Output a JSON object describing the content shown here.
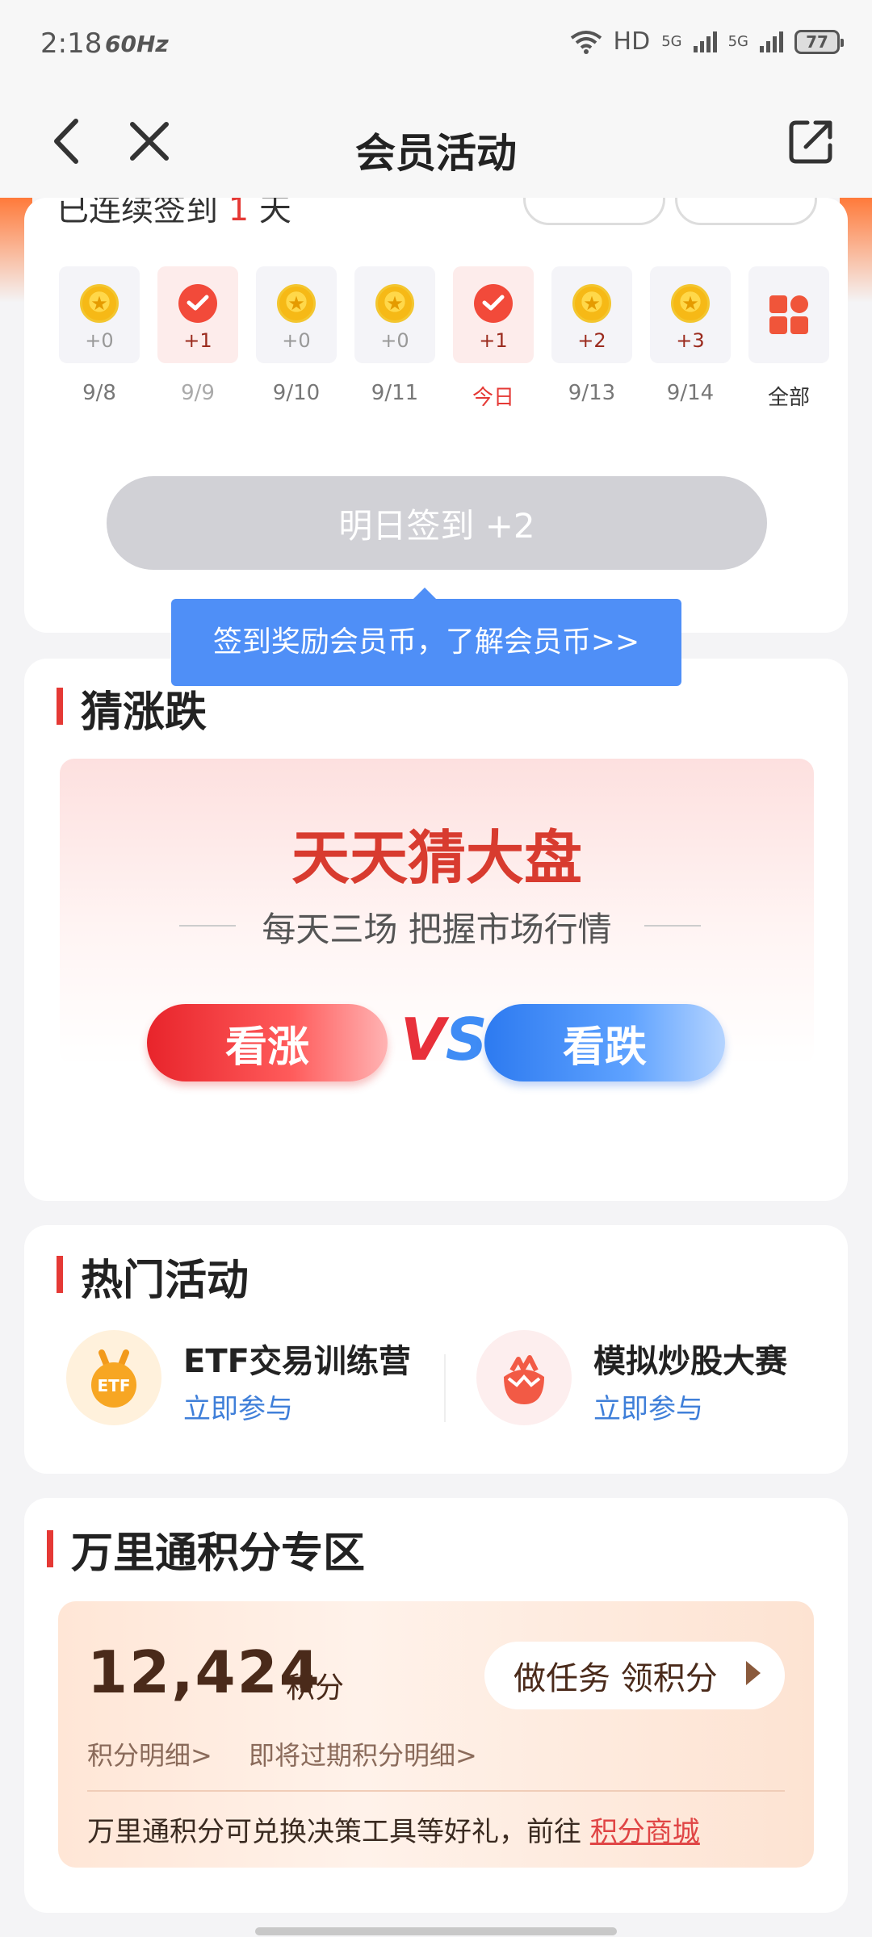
{
  "status_bar": {
    "time": "2:18",
    "refresh": "60Hz",
    "network": "HD",
    "sim1": "5G",
    "sim2": "5G",
    "battery": "77"
  },
  "nav": {
    "title": "会员活动",
    "back_icon": "back-arrow-icon",
    "close_icon": "close-icon",
    "share_icon": "share-icon"
  },
  "checkin": {
    "clipped_text": "已连续签到",
    "clipped_count": "1",
    "clipped_unit": "天",
    "days": [
      {
        "date": "9/8",
        "value": "+0",
        "state": "coin"
      },
      {
        "date": "9/9",
        "value": "+1",
        "state": "checked"
      },
      {
        "date": "9/10",
        "value": "+0",
        "state": "coin"
      },
      {
        "date": "9/11",
        "value": "+0",
        "state": "coin"
      },
      {
        "date": "今日",
        "value": "+1",
        "state": "checked"
      },
      {
        "date": "9/13",
        "value": "+2",
        "state": "coin"
      },
      {
        "date": "9/14",
        "value": "+3",
        "state": "coin"
      }
    ],
    "all_label": "全部",
    "sign_button": "明日签到 +2",
    "tooltip": "签到奖励会员币，了解会员币>>"
  },
  "guess": {
    "title": "猜涨跌",
    "banner_title": "天天猜大盘",
    "banner_subtitle": "每天三场 把握市场行情",
    "up_label": "看涨",
    "vs_v": "V",
    "vs_s": "S",
    "down_label": "看跌"
  },
  "hot": {
    "title": "热门活动",
    "items": [
      {
        "name": "ETF交易训练营",
        "link": "立即参与",
        "icon_text": "ETF"
      },
      {
        "name": "模拟炒股大赛",
        "link": "立即参与"
      }
    ]
  },
  "points": {
    "title": "万里通积分专区",
    "value": "12,424",
    "unit": "积分",
    "task_button": "做任务 领积分",
    "detail_link": "积分明细>",
    "expiring_link": "即将过期积分明细>",
    "note": "万里通积分可兑换决策工具等好礼，前往 ",
    "mall_link": "积分商城"
  }
}
